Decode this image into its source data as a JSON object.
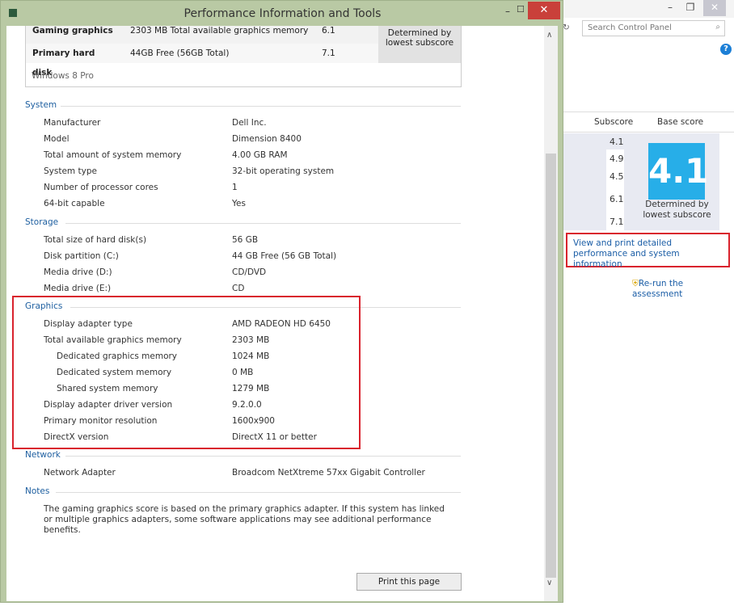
{
  "background_window": {
    "search_placeholder": "Search Control Panel",
    "col_subscore": "Subscore",
    "col_base": "Base score",
    "subscores": [
      "4.1",
      "4.9",
      "4.5",
      "6.1",
      "7.1"
    ],
    "base_score": "4.1",
    "determined": "Determined by lowest subscore",
    "view_link": "View and print detailed performance and system information",
    "rerun": "Re-run the assessment",
    "accent": "#27aee8"
  },
  "dialog": {
    "title": "Performance Information and Tools",
    "score_rows": [
      {
        "label": "Gaming graphics",
        "desc": "2303 MB Total available graphics memory",
        "score": "6.1"
      },
      {
        "label": "Primary hard disk",
        "desc": "44GB Free (56GB Total)",
        "score": "7.1"
      }
    ],
    "determined": "Determined by lowest subscore",
    "edition": "Windows 8 Pro",
    "sections": [
      {
        "title": "System",
        "rows": [
          [
            "Manufacturer",
            "Dell Inc."
          ],
          [
            "Model",
            "Dimension 8400"
          ],
          [
            "Total amount of system memory",
            "4.00 GB RAM"
          ],
          [
            "System type",
            "32-bit operating system"
          ],
          [
            "Number of processor cores",
            "1"
          ],
          [
            "64-bit capable",
            "Yes"
          ]
        ]
      },
      {
        "title": "Storage",
        "rows": [
          [
            "Total size of hard disk(s)",
            "56 GB"
          ],
          [
            "Disk partition (C:)",
            "44 GB Free (56 GB Total)"
          ],
          [
            "Media drive (D:)",
            "CD/DVD"
          ],
          [
            "Media drive (E:)",
            "CD"
          ]
        ]
      },
      {
        "title": "Graphics",
        "rows": [
          [
            "Display adapter type",
            "AMD RADEON HD 6450"
          ],
          [
            "Total available graphics memory",
            "2303 MB"
          ],
          [
            "Dedicated graphics memory",
            "1024 MB"
          ],
          [
            "Dedicated system memory",
            "0 MB"
          ],
          [
            "Shared system memory",
            "1279 MB"
          ],
          [
            "Display adapter driver version",
            "9.2.0.0"
          ],
          [
            "Primary monitor resolution",
            "1600x900"
          ],
          [
            "DirectX version",
            "DirectX 11 or better"
          ]
        ]
      },
      {
        "title": "Network",
        "rows": [
          [
            "Network Adapter",
            "Broadcom NetXtreme 57xx Gigabit Controller"
          ]
        ]
      },
      {
        "title": "Notes",
        "rows": []
      }
    ],
    "notes_text": "The gaming graphics score is based on the primary graphics adapter. If this system has linked or multiple graphics adapters, some software applications may see additional performance benefits.",
    "print_button": "Print this page"
  }
}
